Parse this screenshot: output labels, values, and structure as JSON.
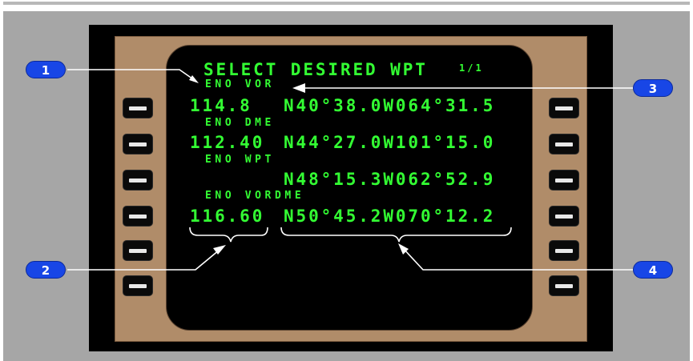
{
  "callouts": [
    "1",
    "2",
    "3",
    "4"
  ],
  "cdu": {
    "title": "SELECT DESIRED WPT",
    "page": "1/1",
    "entries": [
      {
        "label": "ENO VOR",
        "frequency": "114.8",
        "position": "N40°38.0W064°31.5"
      },
      {
        "label": "ENO DME",
        "frequency": "112.40",
        "position": "N44°27.0W101°15.0"
      },
      {
        "label": "ENO WPT",
        "frequency": "",
        "position": "N48°15.3W062°52.9"
      },
      {
        "label": "ENO VORDME",
        "frequency": "116.60",
        "position": "N50°45.2W070°12.2"
      }
    ]
  },
  "colors": {
    "screen_text": "#33ff33",
    "callout_fill": "#1846e6",
    "bezel": "#b08c69"
  }
}
